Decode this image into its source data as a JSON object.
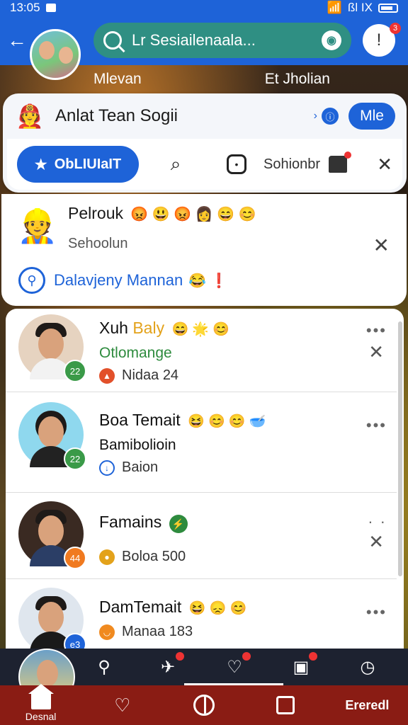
{
  "status_bar": {
    "time": "13:05",
    "right_text": "ßl IX"
  },
  "header": {
    "search_placeholder": "Lr Sesiailenaala...",
    "notification_count": "3",
    "label_left": "Mlevan",
    "label_right": "Et Jholian"
  },
  "group_card": {
    "name": "Anlat Tean Sogii",
    "me_label": "Mle",
    "primary_action": "ObLIUIaIT",
    "secondary_label": "Sohionbr"
  },
  "notice_card": {
    "title": "Pelrouk",
    "title_emojis": "😡 😃 😡 👩 😄 😊",
    "subtitle": "Sehoolun",
    "link_text": "Dalavjeny Mannan",
    "link_emoji": "😂 ❗"
  },
  "contacts": [
    {
      "name_a": "Xuh",
      "name_b": "Baly",
      "emojis": "😄 🌟 😊",
      "status": "Otlomange",
      "status_color": "#2e8b3e",
      "meta": "Nidaa  24",
      "badge": "22",
      "badge_color": "#3a9a48",
      "meta_color": "#e2502a",
      "has_close": true
    },
    {
      "name_a": "Boa Temait",
      "name_b": "",
      "emojis": "😆 😊 😊 🥣",
      "status": "Bamibolioin",
      "status_color": "#111111",
      "meta": "Baion",
      "badge": "22",
      "badge_color": "#3a9a48",
      "meta_color": "#1e63d8",
      "has_close": false
    },
    {
      "name_a": "Famains",
      "name_b": "",
      "emojis": "⚡",
      "status": "",
      "status_color": "#111111",
      "meta": "Boloa  500",
      "badge": "44",
      "badge_color": "#f07a20",
      "meta_color": "#e3a21b",
      "has_close": true
    },
    {
      "name_a": "DamTemait",
      "name_b": "",
      "emojis": "😆 😞 😊",
      "status": "",
      "status_color": "#111111",
      "meta": "Manaa  183",
      "badge": "e3",
      "badge_color": "#1e63d8",
      "meta_color": "#f08a20",
      "has_close": false
    }
  ],
  "bottom_nav": {
    "home_label": "Desnal",
    "right_label": "Ereredl"
  },
  "colors": {
    "primary": "#1e63d8",
    "nav": "#8a1c14",
    "tray": "#1d2230"
  }
}
